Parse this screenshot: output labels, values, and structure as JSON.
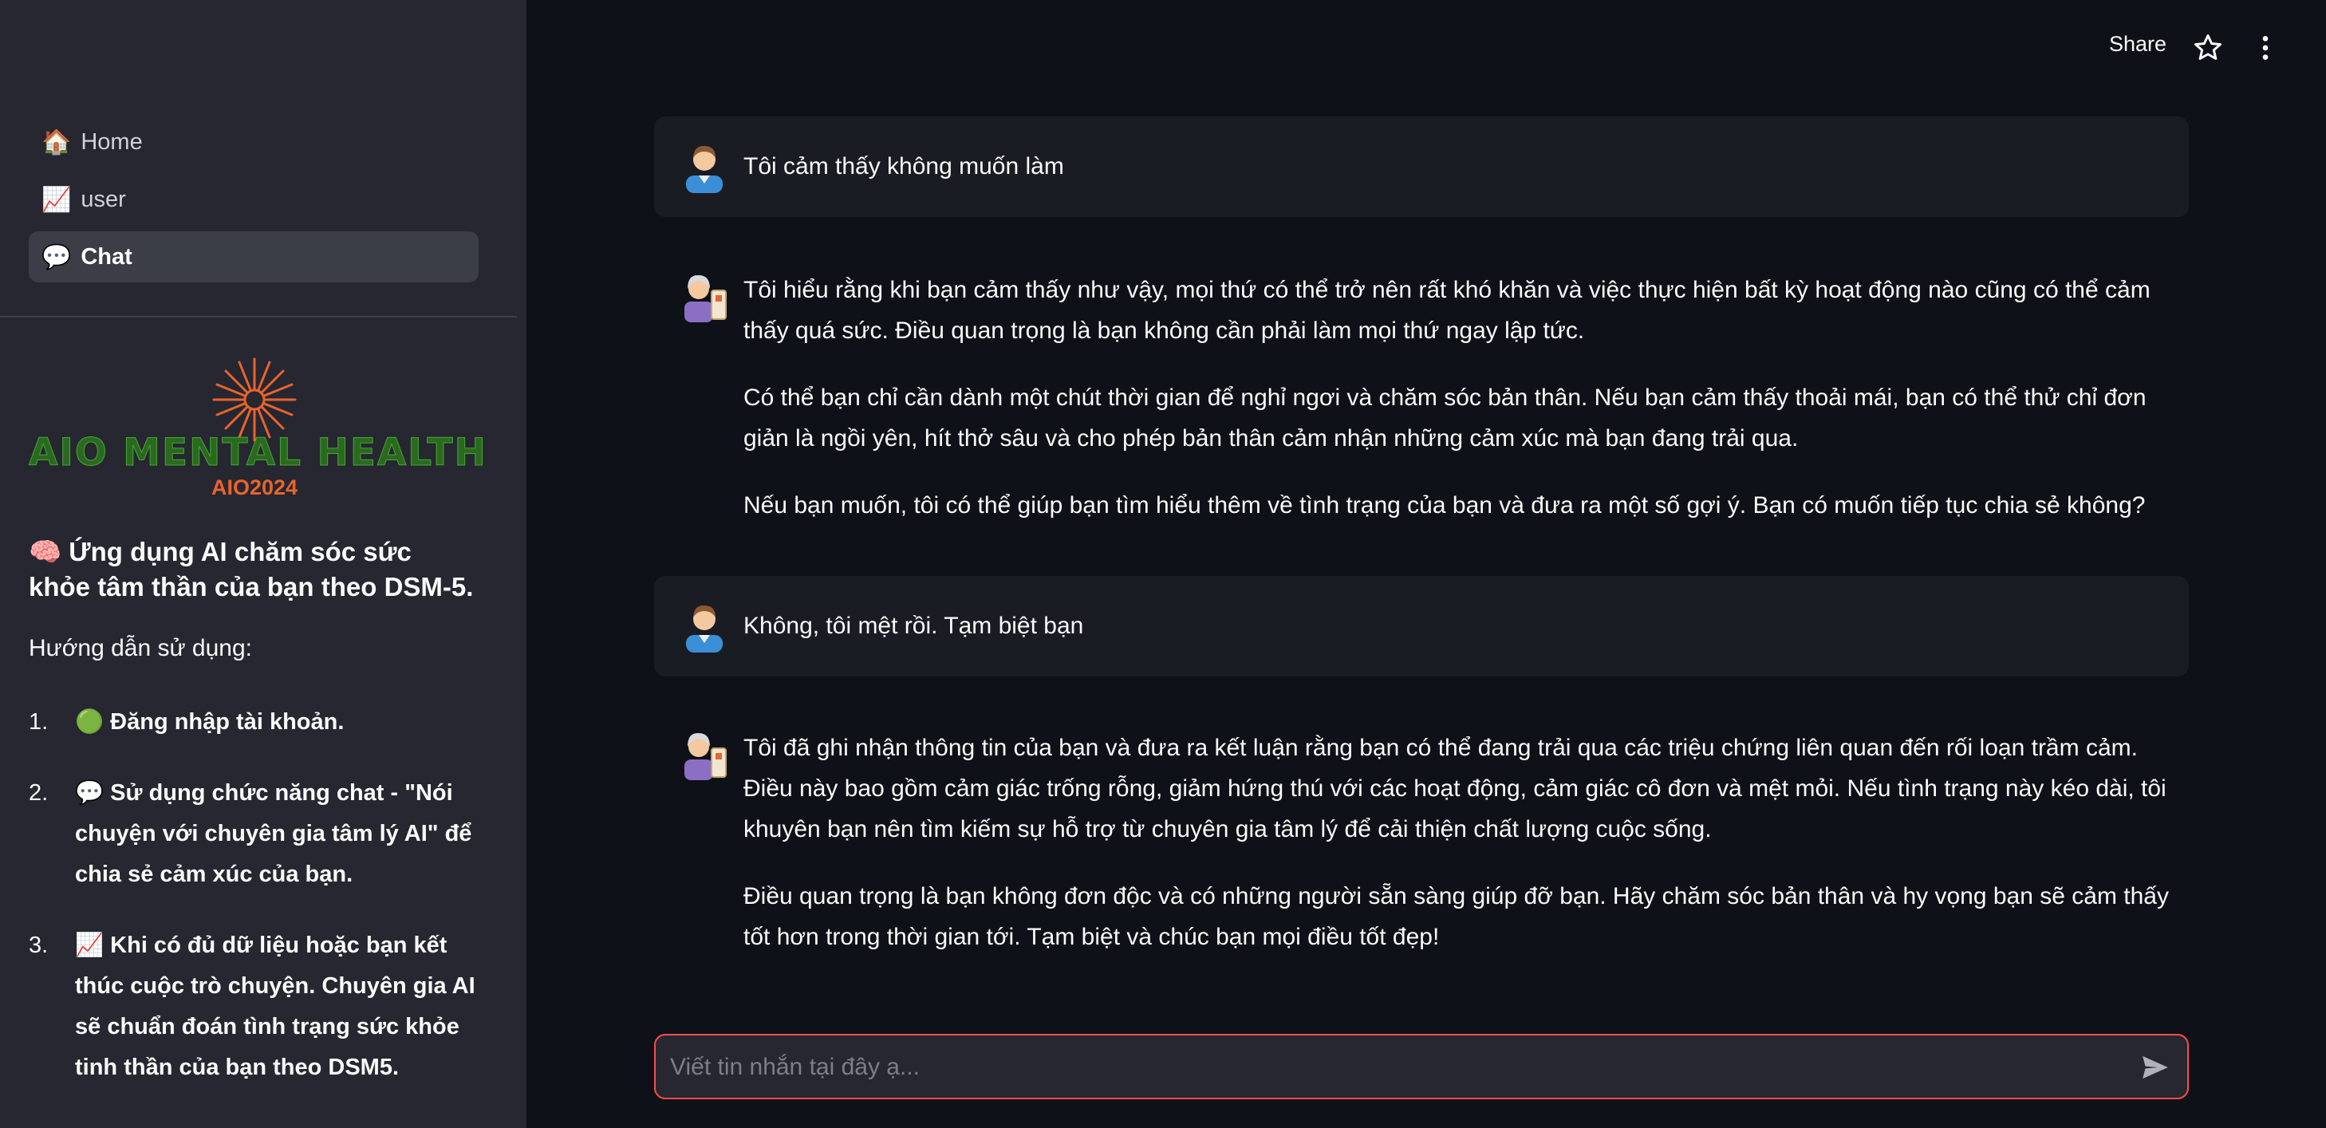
{
  "sidebar": {
    "nav": [
      {
        "emoji": "🏠",
        "label": "Home"
      },
      {
        "emoji": "📈",
        "label": "user"
      },
      {
        "emoji": "💬",
        "label": "Chat"
      }
    ],
    "logo": {
      "text": "AIO MENTAL HEALTH",
      "sub": "AIO2024"
    },
    "app_title": "🧠 Ứng dụng AI chăm sóc sức khỏe tâm thần của bạn theo DSM-5.",
    "guide_title": "Hướng dẫn sử dụng:",
    "steps": [
      {
        "num": "1.",
        "text": "🟢 Đăng nhập tài khoản."
      },
      {
        "num": "2.",
        "text": "💬 Sử dụng chức năng chat - \"Nói chuyện với chuyên gia tâm lý AI\" để chia sẻ cảm xúc của bạn."
      },
      {
        "num": "3.",
        "text": "📈 Khi có đủ dữ liệu hoặc bạn kết thúc cuộc trò chuyện. Chuyên gia AI sẽ chuẩn đoán tình trạng sức khỏe tinh thần của bạn theo DSM5."
      }
    ]
  },
  "header": {
    "share_label": "Share"
  },
  "chat": {
    "messages": [
      {
        "role": "user",
        "paragraphs": [
          "Tôi cảm thấy không muốn làm"
        ]
      },
      {
        "role": "assistant",
        "paragraphs": [
          "Tôi hiểu rằng khi bạn cảm thấy như vậy, mọi thứ có thể trở nên rất khó khăn và việc thực hiện bất kỳ hoạt động nào cũng có thể cảm thấy quá sức. Điều quan trọng là bạn không cần phải làm mọi thứ ngay lập tức.",
          "Có thể bạn chỉ cần dành một chút thời gian để nghỉ ngơi và chăm sóc bản thân. Nếu bạn cảm thấy thoải mái, bạn có thể thử chỉ đơn giản là ngồi yên, hít thở sâu và cho phép bản thân cảm nhận những cảm xúc mà bạn đang trải qua.",
          "Nếu bạn muốn, tôi có thể giúp bạn tìm hiểu thêm về tình trạng của bạn và đưa ra một số gợi ý. Bạn có muốn tiếp tục chia sẻ không?"
        ]
      },
      {
        "role": "user",
        "paragraphs": [
          "Không, tôi mệt rồi. Tạm biệt bạn"
        ]
      },
      {
        "role": "assistant",
        "paragraphs": [
          "Tôi đã ghi nhận thông tin của bạn và đưa ra kết luận rằng bạn có thể đang trải qua các triệu chứng liên quan đến rối loạn trầm cảm. Điều này bao gồm cảm giác trống rỗng, giảm hứng thú với các hoạt động, cảm giác cô đơn và mệt mỏi. Nếu tình trạng này kéo dài, tôi khuyên bạn nên tìm kiếm sự hỗ trợ từ chuyên gia tâm lý để cải thiện chất lượng cuộc sống.",
          "Điều quan trọng là bạn không đơn độc và có những người sẵn sàng giúp đỡ bạn. Hãy chăm sóc bản thân và hy vọng bạn sẽ cảm thấy tốt hơn trong thời gian tới. Tạm biệt và chúc bạn mọi điều tốt đẹp!"
        ]
      }
    ],
    "input": {
      "placeholder": "Viết tin nhắn tại đây ạ...",
      "value": ""
    }
  },
  "colors": {
    "accent": "#ff4b4b",
    "background": "#0e1117",
    "sidebar": "#262730",
    "user_bubble": "#1a1c24"
  },
  "icons": [
    "star-icon",
    "more-vertical-icon",
    "send-icon",
    "user-avatar-icon",
    "assistant-avatar-icon"
  ]
}
